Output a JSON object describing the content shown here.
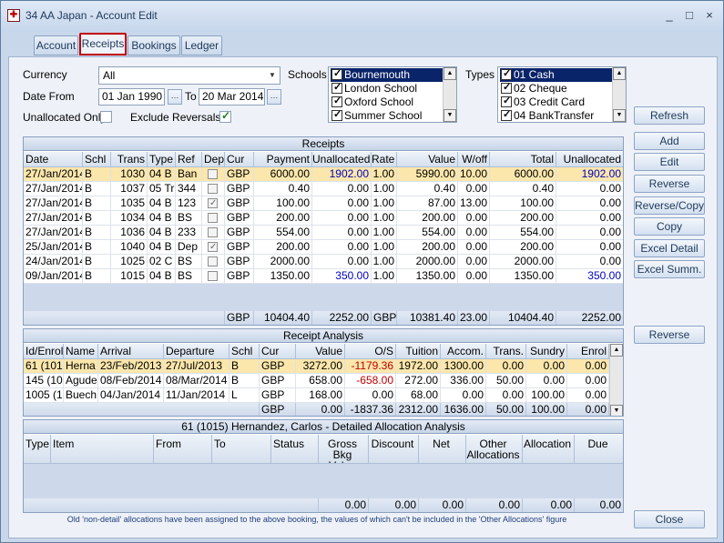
{
  "window": {
    "title": "34 AA Japan - Account Edit",
    "controls": [
      "_",
      "□",
      "×"
    ]
  },
  "tabs": [
    "Account",
    "Receipts",
    "Bookings",
    "Ledger"
  ],
  "filters": {
    "currency_label": "Currency",
    "currency_value": "All",
    "date_from_label": "Date From",
    "date_from": "01 Jan 1990",
    "to_label": "To",
    "date_to": "20 Mar 2014",
    "unallocated_only_label": "Unallocated Only",
    "exclude_reversals_label": "Exclude Reversals",
    "schools_label": "Schools",
    "schools": [
      "Bournemouth School",
      "London School",
      "Oxford School",
      "Summer School"
    ],
    "types_label": "Types",
    "types": [
      "01 Cash",
      "02 Cheque",
      "03 Credit Card",
      "04 BankTransfer"
    ]
  },
  "buttons": {
    "refresh": "Refresh",
    "add": "Add",
    "edit": "Edit",
    "reverse": "Reverse",
    "reverse_copy": "Reverse/Copy",
    "copy": "Copy",
    "excel_detail": "Excel Detail",
    "excel_summ": "Excel Summ.",
    "reverse2": "Reverse",
    "close": "Close"
  },
  "receipts": {
    "caption": "Receipts",
    "headers": [
      "Date",
      "Schl",
      "Trans",
      "Type",
      "Ref",
      "Dep",
      "Cur",
      "Payment",
      "Unallocated",
      "Rate",
      "Value",
      "W/off",
      "Total",
      "Unallocated"
    ],
    "rows": [
      [
        "27/Jan/2014",
        "B",
        "1030",
        "04 B",
        "Ban",
        false,
        "GBP",
        "6000.00",
        "1902.00",
        "1.00",
        "5990.00",
        "10.00",
        "6000.00",
        "1902.00"
      ],
      [
        "27/Jan/2014",
        "B",
        "1037",
        "05 Tr",
        "344",
        false,
        "GBP",
        "0.40",
        "0.00",
        "1.00",
        "0.40",
        "0.00",
        "0.40",
        "0.00"
      ],
      [
        "27/Jan/2014",
        "B",
        "1035",
        "04 B",
        "123",
        true,
        "GBP",
        "100.00",
        "0.00",
        "1.00",
        "87.00",
        "13.00",
        "100.00",
        "0.00"
      ],
      [
        "27/Jan/2014",
        "B",
        "1034",
        "04 B",
        "BS",
        false,
        "GBP",
        "200.00",
        "0.00",
        "1.00",
        "200.00",
        "0.00",
        "200.00",
        "0.00"
      ],
      [
        "27/Jan/2014",
        "B",
        "1036",
        "04 B",
        "233",
        false,
        "GBP",
        "554.00",
        "0.00",
        "1.00",
        "554.00",
        "0.00",
        "554.00",
        "0.00"
      ],
      [
        "25/Jan/2014",
        "B",
        "1040",
        "04 B",
        "Dep",
        true,
        "GBP",
        "200.00",
        "0.00",
        "1.00",
        "200.00",
        "0.00",
        "200.00",
        "0.00"
      ],
      [
        "24/Jan/2014",
        "B",
        "1025",
        "02 C",
        "BS",
        false,
        "GBP",
        "2000.00",
        "0.00",
        "1.00",
        "2000.00",
        "0.00",
        "2000.00",
        "0.00"
      ],
      [
        "09/Jan/2014",
        "B",
        "1015",
        "04 B",
        "BS",
        false,
        "GBP",
        "1350.00",
        "350.00",
        "1.00",
        "1350.00",
        "0.00",
        "1350.00",
        "350.00"
      ]
    ],
    "totals": {
      "cur": "GBP",
      "payment": "10404.40",
      "unallocated": "2252.00",
      "rate_cur": "GBP",
      "value": "10381.40",
      "woff": "23.00",
      "total": "10404.40",
      "unallocated2": "2252.00"
    }
  },
  "analysis": {
    "caption": "Receipt Analysis",
    "headers": [
      "Id/Enrol",
      "Name",
      "Arrival",
      "Departure",
      "Schl",
      "Cur",
      "Value",
      "O/S",
      "Tuition",
      "Accom.",
      "Trans.",
      "Sundry",
      "Enrol"
    ],
    "rows": [
      [
        "61 (101",
        "Herna",
        "23/Feb/2013",
        "27/Jul/2013",
        "B",
        "GBP",
        "3272.00",
        "-1179.36",
        "1972.00",
        "1300.00",
        "0.00",
        "0.00",
        "0.00"
      ],
      [
        "145 (10",
        "Agudel",
        "08/Feb/2014",
        "08/Mar/2014",
        "B",
        "GBP",
        "658.00",
        "-658.00",
        "272.00",
        "336.00",
        "50.00",
        "0.00",
        "0.00"
      ],
      [
        "1005 (1",
        "Buech",
        "04/Jan/2014",
        "11/Jan/2014",
        "L",
        "GBP",
        "168.00",
        "0.00",
        "68.00",
        "0.00",
        "0.00",
        "100.00",
        "0.00"
      ]
    ],
    "totals": {
      "cur": "GBP",
      "value": "0.00",
      "os": "-1837.36",
      "tuition": "2312.00",
      "accom": "1636.00",
      "trans": "50.00",
      "sundry": "100.00",
      "enrol": "0.00"
    }
  },
  "detail": {
    "caption": "61 (1015) Hernandez, Carlos - Detailed Allocation Analysis",
    "headers": [
      "Type",
      "Item",
      "From",
      "To",
      "Status",
      "Gross Bkg Value",
      "Discount",
      "Net",
      "Other Allocations",
      "Allocation",
      "Due"
    ],
    "totals": [
      "0.00",
      "0.00",
      "0.00",
      "0.00",
      "0.00",
      "0.00"
    ]
  },
  "note": "Old 'non-detail' allocations have been assigned to the above booking, the values of which can't be included in the 'Other Allocations' figure"
}
